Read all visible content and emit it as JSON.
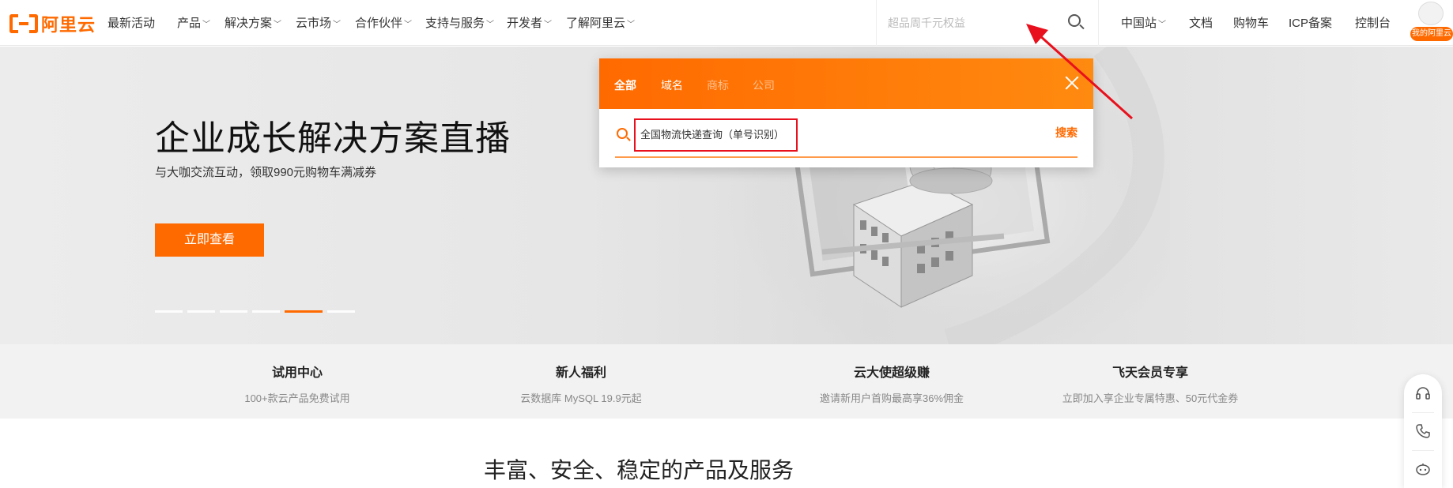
{
  "logo": {
    "text": "阿里云",
    "brand_color": "#ff6a00"
  },
  "nav": {
    "items": [
      {
        "label": "最新活动",
        "dropdown": false
      },
      {
        "label": "产品",
        "dropdown": true
      },
      {
        "label": "解决方案",
        "dropdown": true
      },
      {
        "label": "云市场",
        "dropdown": true
      },
      {
        "label": "合作伙伴",
        "dropdown": true
      },
      {
        "label": "支持与服务",
        "dropdown": true
      },
      {
        "label": "开发者",
        "dropdown": true
      },
      {
        "label": "了解阿里云",
        "dropdown": true
      }
    ],
    "search_placeholder": "超品周千元权益",
    "right_items": [
      {
        "label": "中国站"
      },
      {
        "label": "文档"
      },
      {
        "label": "购物车"
      },
      {
        "label": "ICP备案"
      },
      {
        "label": "控制台"
      }
    ],
    "avatar_label": "我的阿里云"
  },
  "hero": {
    "title": "企业成长解决方案直播",
    "subtitle": "与大咖交流互动，领取990元购物车满减券",
    "button": "立即查看",
    "carousel": {
      "count": 6,
      "active_index": 4
    }
  },
  "search_popup": {
    "tabs": [
      "全部",
      "域名",
      "商标",
      "公司"
    ],
    "active_tab": 0,
    "query": "全国物流快递查询（单号识别）",
    "search_label": "搜索"
  },
  "features": [
    {
      "title": "试用中心",
      "desc": "100+款云产品免费试用"
    },
    {
      "title": "新人福利",
      "desc": "云数据库 MySQL 19.9元起"
    },
    {
      "title": "云大使超级赚",
      "desc": "邀请新用户首购最高享36%佣金"
    },
    {
      "title": "飞天会员专享",
      "desc": "立即加入享企业专属特惠、50元代金券"
    }
  ],
  "section_title": "丰富、安全、稳定的产品及服务",
  "side_toolbar": {
    "icons": [
      "headset-icon",
      "phone-icon",
      "robot-icon"
    ]
  },
  "annotation": {
    "color": "#e8101c"
  }
}
